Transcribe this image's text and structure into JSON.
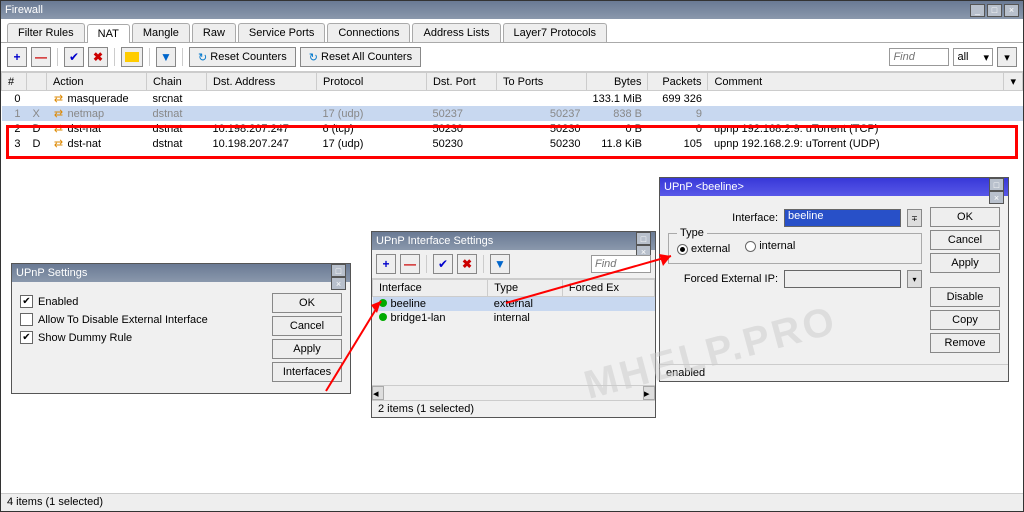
{
  "main": {
    "title": "Firewall",
    "tabs": [
      "Filter Rules",
      "NAT",
      "Mangle",
      "Raw",
      "Service Ports",
      "Connections",
      "Address Lists",
      "Layer7 Protocols"
    ],
    "activeTab": "NAT",
    "resetCounters": "Reset Counters",
    "resetAllCounters": "Reset All Counters",
    "findPlaceholder": "Find",
    "filterAll": "all",
    "headers": {
      "num": "#",
      "action": "Action",
      "chain": "Chain",
      "dstAddr": "Dst. Address",
      "protocol": "Protocol",
      "dstPort": "Dst. Port",
      "toPorts": "To Ports",
      "bytes": "Bytes",
      "packets": "Packets",
      "comment": "Comment"
    },
    "rows": [
      {
        "n": "0",
        "flag": "",
        "action": "masquerade",
        "chain": "srcnat",
        "dstAddr": "",
        "protocol": "",
        "dstPort": "",
        "toPorts": "",
        "bytes": "133.1 MiB",
        "packets": "699 326",
        "comment": ""
      },
      {
        "n": "1",
        "flag": "X",
        "action": "netmap",
        "chain": "dstnat",
        "dstAddr": "",
        "protocol": "17 (udp)",
        "dstPort": "50237",
        "toPorts": "50237",
        "bytes": "838 B",
        "packets": "9",
        "comment": ""
      },
      {
        "n": "2",
        "flag": "D",
        "action": "dst-nat",
        "chain": "dstnat",
        "dstAddr": "10.198.207.247",
        "protocol": "6 (tcp)",
        "dstPort": "50230",
        "toPorts": "50230",
        "bytes": "0 B",
        "packets": "0",
        "comment": "upnp 192.168.2.9: uTorrent (TCP)"
      },
      {
        "n": "3",
        "flag": "D",
        "action": "dst-nat",
        "chain": "dstnat",
        "dstAddr": "10.198.207.247",
        "protocol": "17 (udp)",
        "dstPort": "50230",
        "toPorts": "50230",
        "bytes": "11.8 KiB",
        "packets": "105",
        "comment": "upnp 192.168.2.9: uTorrent (UDP)"
      }
    ],
    "status": "4 items (1 selected)"
  },
  "upnpSettings": {
    "title": "UPnP Settings",
    "enabled": "Enabled",
    "allowDisable": "Allow To Disable External Interface",
    "showDummy": "Show Dummy Rule",
    "ok": "OK",
    "cancel": "Cancel",
    "apply": "Apply",
    "interfaces": "Interfaces"
  },
  "upnpIface": {
    "title": "UPnP Interface Settings",
    "findPlaceholder": "Find",
    "headers": {
      "iface": "Interface",
      "type": "Type",
      "forced": "Forced Ex"
    },
    "rows": [
      {
        "name": "beeline",
        "type": "external"
      },
      {
        "name": "bridge1-lan",
        "type": "internal"
      }
    ],
    "status": "2 items (1 selected)"
  },
  "upnpBeeline": {
    "title": "UPnP <beeline>",
    "ifaceLabel": "Interface:",
    "ifaceValue": "beeline",
    "typeLabel": "Type",
    "external": "external",
    "internal": "internal",
    "forcedLabel": "Forced External IP:",
    "ok": "OK",
    "cancel": "Cancel",
    "apply": "Apply",
    "disable": "Disable",
    "copy": "Copy",
    "remove": "Remove",
    "status": "enabled"
  },
  "watermark": "MHELP.PRO"
}
